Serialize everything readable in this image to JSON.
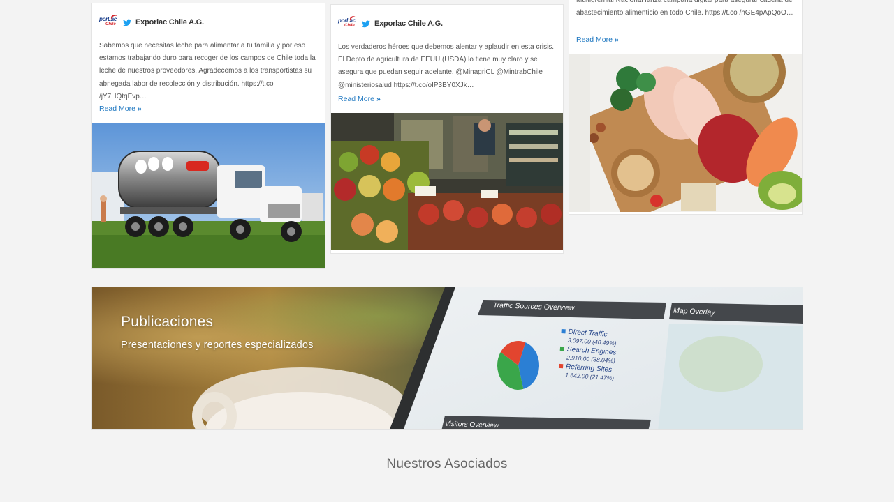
{
  "posts": [
    {
      "author": "Exporlac Chile A.G.",
      "logo_text_1": "porLac",
      "logo_text_2": "Chile",
      "text": "Sabemos que necesitas leche para alimentar a tu familia y por eso estamos trabajando duro para recoger de los campos de Chile toda la leche de nuestros proveedores. Agradecemos a los transportistas su abnegada labor de recolección y distribución. https://t.co /jY7HQtqEvp…",
      "read_more": "Read More",
      "read_more_icon": "double-chevron-right-icon",
      "image": "milk-tanker-truck"
    },
    {
      "author": "Exporlac Chile A.G.",
      "logo_text_1": "porLac",
      "logo_text_2": "Chile",
      "text": "Los verdaderos héroes que debemos alentar y aplaudir en esta crisis. El Depto de agricultura de EEUU (USDA) lo tiene muy claro y se asegura que puedan seguir adelante. @MinagriCL @MintrabChile @ministeriosalud https://t.co/oIP3BY0XJk…",
      "read_more": "Read More",
      "read_more_icon": "double-chevron-right-icon",
      "image": "produce-market"
    },
    {
      "text": "Multigremial Nacional lanza campaña digital para asegurar cadena de abastecimiento alimenticio en todo Chile. https://t.co /hGE4pApQoO…",
      "read_more": "Read More",
      "read_more_icon": "double-chevron-right-icon",
      "image": "food-table"
    }
  ],
  "banner": {
    "title": "Publicaciones",
    "subtitle": "Presentaciones y reportes especializados",
    "screen_heading_1": "Traffic Sources Overview",
    "screen_heading_2": "Map Overlay",
    "screen_heading_3": "Visitors Overview",
    "legend": [
      {
        "label": "Direct Traffic",
        "value": "3,097.00 (40.49%)",
        "color": "#2b7fd4"
      },
      {
        "label": "Search Engines",
        "value": "2,910.00 (38.04%)",
        "color": "#3aa64a"
      },
      {
        "label": "Referring Sites",
        "value": "1,642.00 (21.47%)",
        "color": "#e2452f"
      }
    ]
  },
  "section": {
    "title": "Nuestros Asociados"
  },
  "colors": {
    "link": "#1f78c1",
    "twitter": "#1da1f2",
    "background": "#f3f3f3"
  }
}
